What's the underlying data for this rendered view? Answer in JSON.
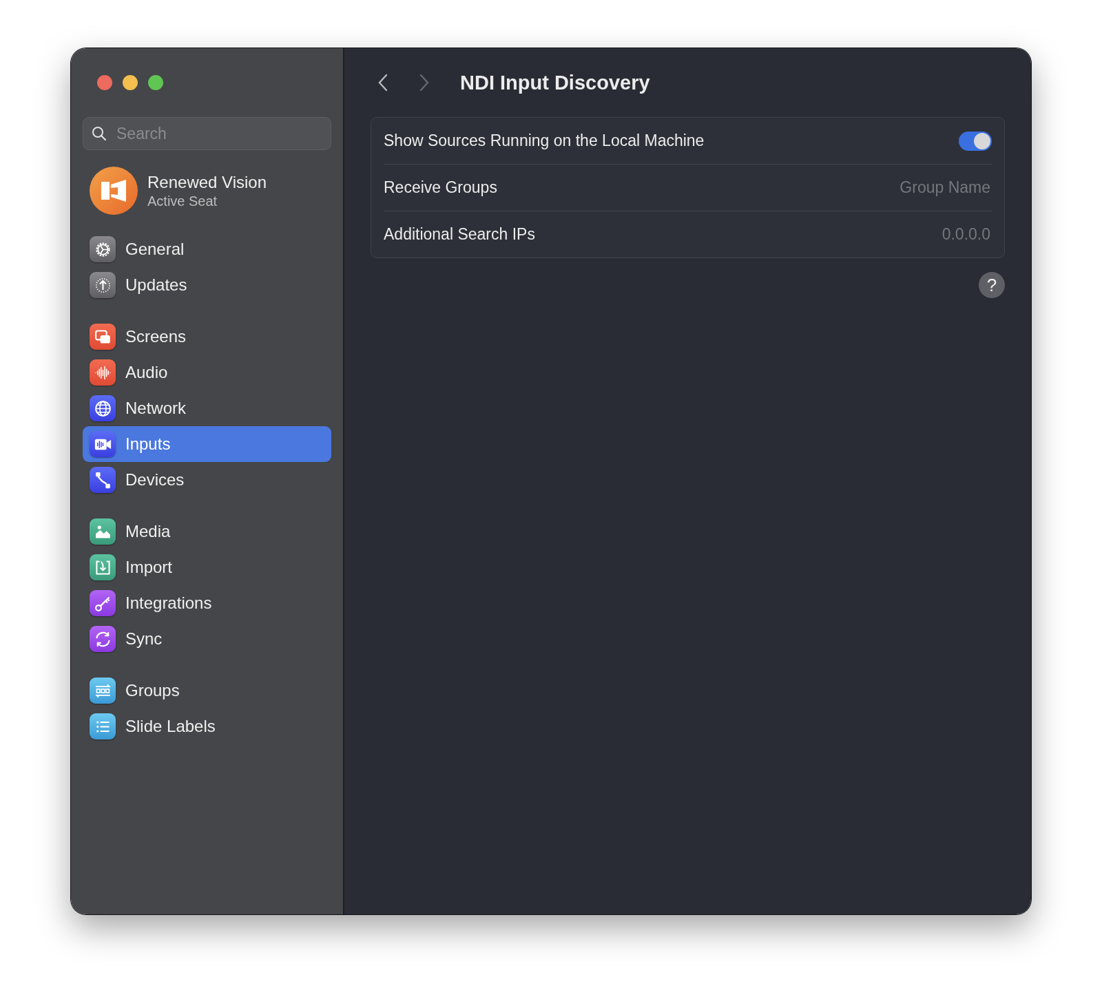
{
  "sidebar": {
    "search": {
      "placeholder": "Search"
    },
    "account": {
      "name": "Renewed Vision",
      "subtitle": "Active Seat"
    },
    "groups": [
      {
        "items": [
          {
            "label": "General",
            "selected": false
          },
          {
            "label": "Updates",
            "selected": false
          }
        ]
      },
      {
        "items": [
          {
            "label": "Screens",
            "selected": false
          },
          {
            "label": "Audio",
            "selected": false
          },
          {
            "label": "Network",
            "selected": false
          },
          {
            "label": "Inputs",
            "selected": true
          },
          {
            "label": "Devices",
            "selected": false
          }
        ]
      },
      {
        "items": [
          {
            "label": "Media",
            "selected": false
          },
          {
            "label": "Import",
            "selected": false
          },
          {
            "label": "Integrations",
            "selected": false
          },
          {
            "label": "Sync",
            "selected": false
          }
        ]
      },
      {
        "items": [
          {
            "label": "Groups",
            "selected": false
          },
          {
            "label": "Slide Labels",
            "selected": false
          }
        ]
      }
    ]
  },
  "content": {
    "title": "NDI Input Discovery",
    "settings": [
      {
        "kind": "toggle",
        "label": "Show Sources Running on the Local Machine",
        "on": true
      },
      {
        "kind": "text",
        "label": "Receive Groups",
        "placeholder": "Group Name"
      },
      {
        "kind": "text",
        "label": "Additional Search IPs",
        "placeholder": "0.0.0.0"
      }
    ],
    "help": "?"
  }
}
